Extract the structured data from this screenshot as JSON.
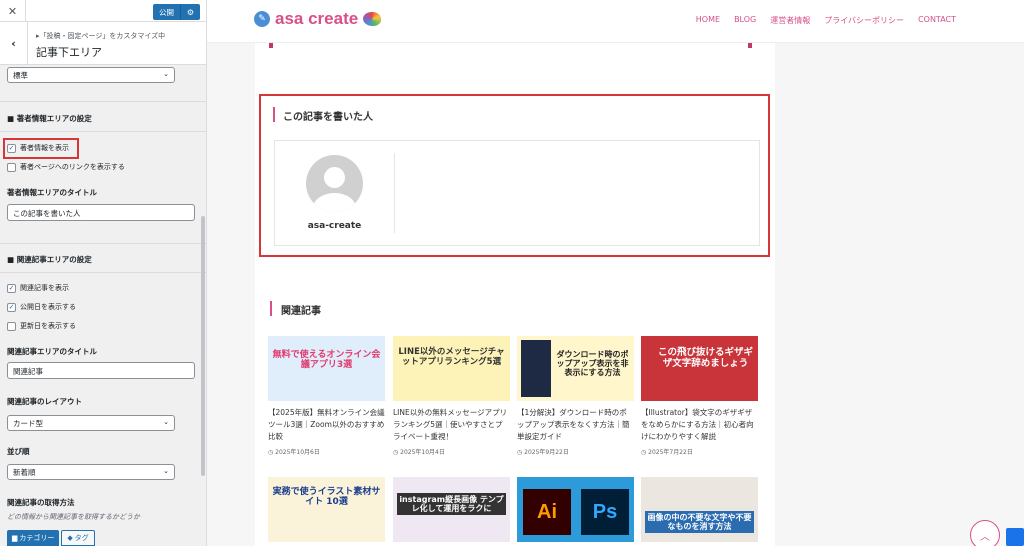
{
  "customizer": {
    "publish_label": "公開",
    "breadcrumb": "▸「投稿・固定ページ」をカスタマイズ中",
    "section_title": "記事下エリア",
    "top_select_value": "標準",
    "author_section": {
      "heading": "著者情報エリアの設定",
      "show_author_label": "著者情報を表示",
      "show_author_checked": true,
      "link_author_label": "著者ページへのリンクを表示する",
      "link_author_checked": false,
      "title_label": "著者情報エリアのタイトル",
      "title_value": "この記事を書いた人"
    },
    "related_section": {
      "heading": "関連記事エリアの設定",
      "show_related_label": "関連記事を表示",
      "show_date_label": "公開日を表示する",
      "show_updated_label": "更新日を表示する",
      "title_label": "関連記事エリアのタイトル",
      "title_value": "関連記事",
      "layout_label": "関連記事のレイアウト",
      "layout_value": "カード型",
      "order_label": "並び順",
      "order_value": "新着順",
      "source_label": "関連記事の取得方法",
      "source_note": "どの情報から関連記事を取得するかどうか",
      "tab_category": "カテゴリー",
      "tab_tag": "タグ"
    }
  },
  "site": {
    "logo_text": "asa create",
    "nav": [
      "HOME",
      "BLOG",
      "運営者情報",
      "プライバシーポリシー",
      "CONTACT"
    ],
    "author_heading": "この記事を書いた人",
    "author_name": "asa-create",
    "related_heading": "関連記事",
    "cards": [
      {
        "title": "【2025年版】無料オンライン会議ツール3選｜Zoom以外のおすすめ比較",
        "date": "◷ 2025年10月6日",
        "thumb_text": "無料で使えるオンライン会議アプリ3選",
        "thumb_bg": "#dfeefa",
        "thumb_fg": "#e23a6e"
      },
      {
        "title": "LINE以外の無料メッセージアプリランキング5選｜使いやすさとプライベート重視！",
        "date": "◷ 2025年10月4日",
        "thumb_text": "LINE以外のメッセージチャットアプリランキング5選",
        "thumb_bg": "#fdf3b8",
        "thumb_fg": "#333333"
      },
      {
        "title": "【1分解決】ダウンロード時のポップアップ表示をなくす方法｜簡単設定ガイド",
        "date": "◷ 2025年9月22日",
        "thumb_text": "ダウンロード時のポップアップ表示を非表示にする方法",
        "thumb_bg": "#fff6cc",
        "thumb_fg": "#222222"
      },
      {
        "title": "【Illustrator】袋文字のギザギザをなめらかにする方法｜初心者向けにわかりやすく解説",
        "date": "◷ 2025年7月22日",
        "thumb_text": "この飛び抜けるギザギザ文字辞めましょう",
        "thumb_bg": "#c8343a",
        "thumb_fg": "#ffffff"
      },
      {
        "title": "",
        "date": "",
        "thumb_text": "実務で使うイラスト素材サイト 10選",
        "thumb_bg": "#fbf3d9",
        "thumb_fg": "#1a3f8f"
      },
      {
        "title": "",
        "date": "",
        "thumb_text": "instagram縦長画像 テンプレ化して運用をラクに",
        "thumb_bg": "#efe7f2",
        "thumb_fg": "#ffffff"
      },
      {
        "title": "",
        "date": "",
        "thumb_text": "Ai Ps",
        "thumb_bg": "#2d9bd9",
        "thumb_fg": "#ff9a00"
      },
      {
        "title": "",
        "date": "",
        "thumb_text": "画像の中の不要な文字や不要なものを消す方法",
        "thumb_bg": "#ece6e0",
        "thumb_fg": "#2b6cb0"
      }
    ]
  }
}
